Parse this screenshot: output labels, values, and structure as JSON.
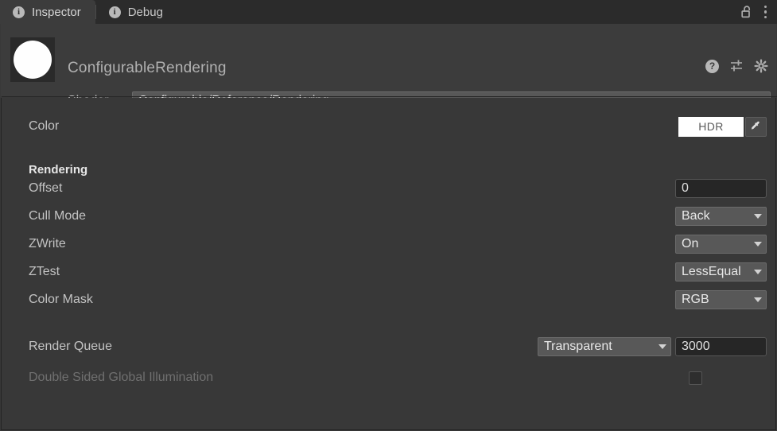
{
  "window": {
    "tabs": [
      {
        "label": "Inspector",
        "icon": "info-icon",
        "active": true
      },
      {
        "label": "Debug",
        "icon": "info-icon",
        "active": false
      }
    ],
    "lock_icon": "unlocked-padlock-icon",
    "menu_icon": "kebab-menu-icon"
  },
  "material_header": {
    "title": "ConfigurableRendering",
    "preview_icon": "material-preview-sphere",
    "help_icon": "help-icon",
    "help_glyph": "?",
    "preset_icon": "preset-sliders-icon",
    "settings_icon": "gear-icon",
    "shader_label": "Shader",
    "shader_value": "Configurable/Reference/Rendering"
  },
  "properties": {
    "color": {
      "label": "Color",
      "swatch_text": "HDR",
      "swatch_color": "#ffffff",
      "eyedropper_icon": "eyedropper-icon"
    },
    "section_rendering": "Rendering",
    "offset": {
      "label": "Offset",
      "value": "0"
    },
    "cull_mode": {
      "label": "Cull Mode",
      "value": "Back"
    },
    "zwrite": {
      "label": "ZWrite",
      "value": "On"
    },
    "ztest": {
      "label": "ZTest",
      "value": "LessEqual"
    },
    "color_mask": {
      "label": "Color Mask",
      "value": "RGB"
    },
    "render_queue": {
      "label": "Render Queue",
      "preset": "Transparent",
      "value": "3000"
    },
    "double_sided_gi": {
      "label": "Double Sided Global Illumination",
      "checked": false,
      "disabled": true
    }
  },
  "colors": {
    "window_bg": "#383838",
    "tabbar_bg": "#2b2b2b",
    "header_bg": "#3c3c3c",
    "dropdown_bg": "#585858",
    "field_bg": "#262626",
    "text": "#c3c3c3",
    "text_bright": "#e6e6e6",
    "text_disabled": "#6f6f6f"
  }
}
